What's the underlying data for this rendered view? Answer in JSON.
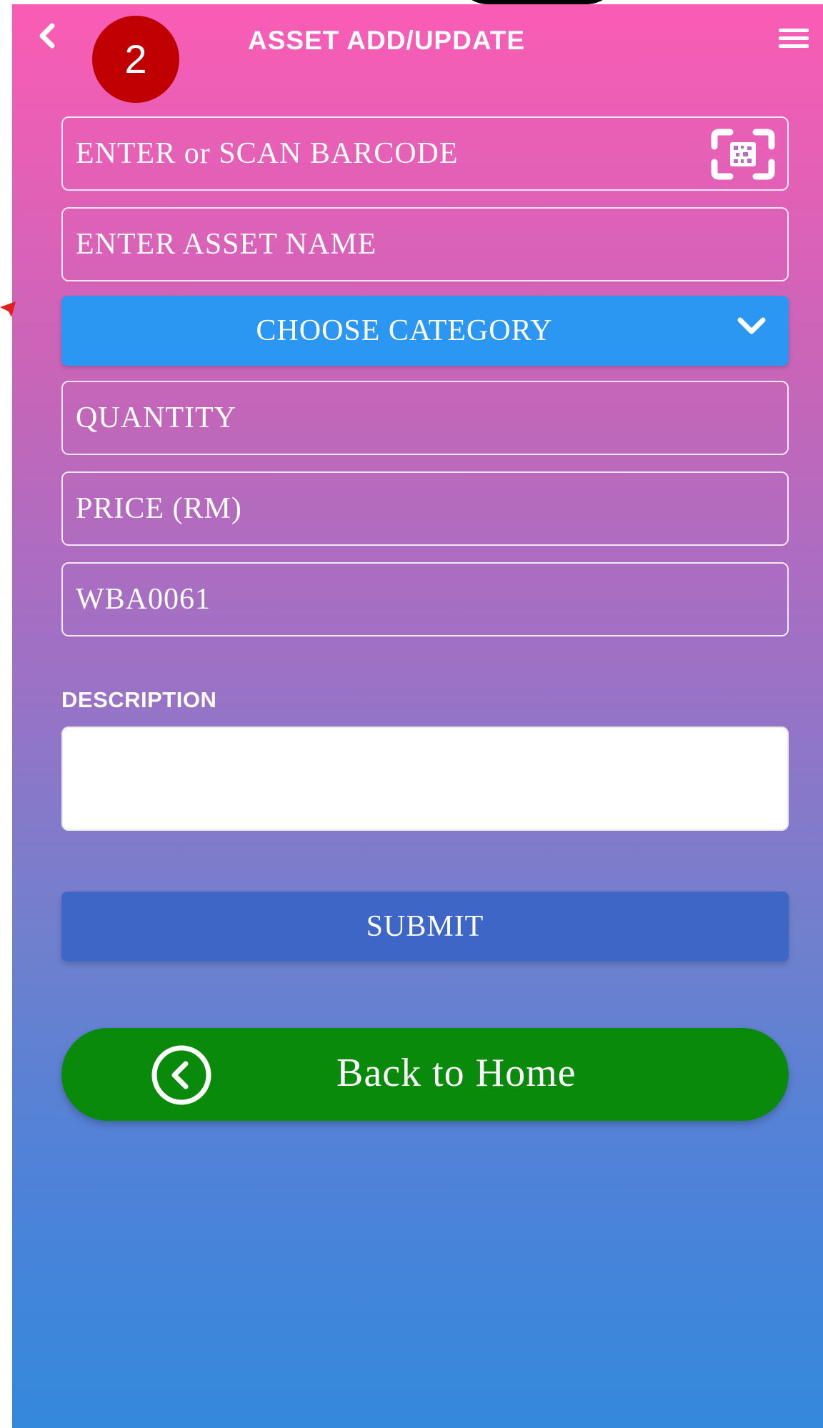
{
  "header": {
    "title": "ASSET ADD/UPDATE",
    "step_badge": "2",
    "back_icon": "chevron-left-icon",
    "menu_icon": "hamburger-menu-icon"
  },
  "form": {
    "barcode": {
      "placeholder": "ENTER or SCAN BARCODE",
      "icon": "barcode-scan-icon"
    },
    "asset_name": {
      "placeholder": "ENTER ASSET NAME"
    },
    "category": {
      "label": "CHOOSE CATEGORY",
      "icon": "chevron-down-icon"
    },
    "quantity": {
      "placeholder": "QUANTITY"
    },
    "price": {
      "placeholder": "PRICE (RM)"
    },
    "asset_code": {
      "value": "WBA0061"
    },
    "description": {
      "label": "DESCRIPTION",
      "value": ""
    },
    "submit": {
      "label": "SUBMIT"
    }
  },
  "home_button": {
    "label": "Back to Home",
    "icon": "circle-chevron-left-icon"
  },
  "colors": {
    "gradient_top": "#fb5cb4",
    "gradient_bottom": "#3389dc",
    "category_button": "#2c97f2",
    "submit_button": "#3e66c6",
    "home_button": "#0a8a0a",
    "step_badge": "#c00000"
  }
}
